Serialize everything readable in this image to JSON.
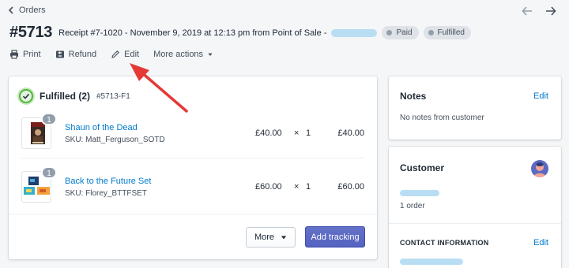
{
  "header": {
    "back_label": "Orders",
    "order_number": "#5713",
    "receipt_text": "Receipt #7-1020 - November 9, 2019 at 12:13 pm from Point of Sale -",
    "badges": [
      "Paid",
      "Fulfilled"
    ]
  },
  "actions": {
    "print": "Print",
    "refund": "Refund",
    "edit": "Edit",
    "more": "More actions"
  },
  "fulfillment": {
    "title": "Fulfilled (2)",
    "id": "#5713-F1",
    "items": [
      {
        "name": "Shaun of the Dead",
        "sku": "SKU: Matt_Ferguson_SOTD",
        "qty_badge": "1",
        "price": "£40.00",
        "times": "×",
        "qty": "1",
        "total": "£40.00"
      },
      {
        "name": "Back to the Future Set",
        "sku": "SKU: Florey_BTTFSET",
        "qty_badge": "1",
        "price": "£60.00",
        "times": "×",
        "qty": "1",
        "total": "£60.00"
      }
    ],
    "more_button": "More",
    "tracking_button": "Add tracking"
  },
  "notes": {
    "title": "Notes",
    "edit": "Edit",
    "text": "No notes from customer"
  },
  "customer": {
    "title": "Customer",
    "orders": "1 order",
    "contact_title": "CONTACT INFORMATION",
    "contact_edit": "Edit"
  },
  "colors": {
    "link": "#007ace",
    "primary_button": "#5c6ac4",
    "fulfilled_green": "#50b83c",
    "badge_bg": "#dfe3e8",
    "annotation_arrow": "#e53935",
    "redaction": "#b9def4"
  },
  "icons": [
    "chevron-left-icon",
    "arrow-left-icon",
    "arrow-right-icon",
    "print-icon",
    "refund-icon",
    "pencil-icon",
    "caret-down-icon",
    "check-circle-icon",
    "avatar-icon"
  ]
}
